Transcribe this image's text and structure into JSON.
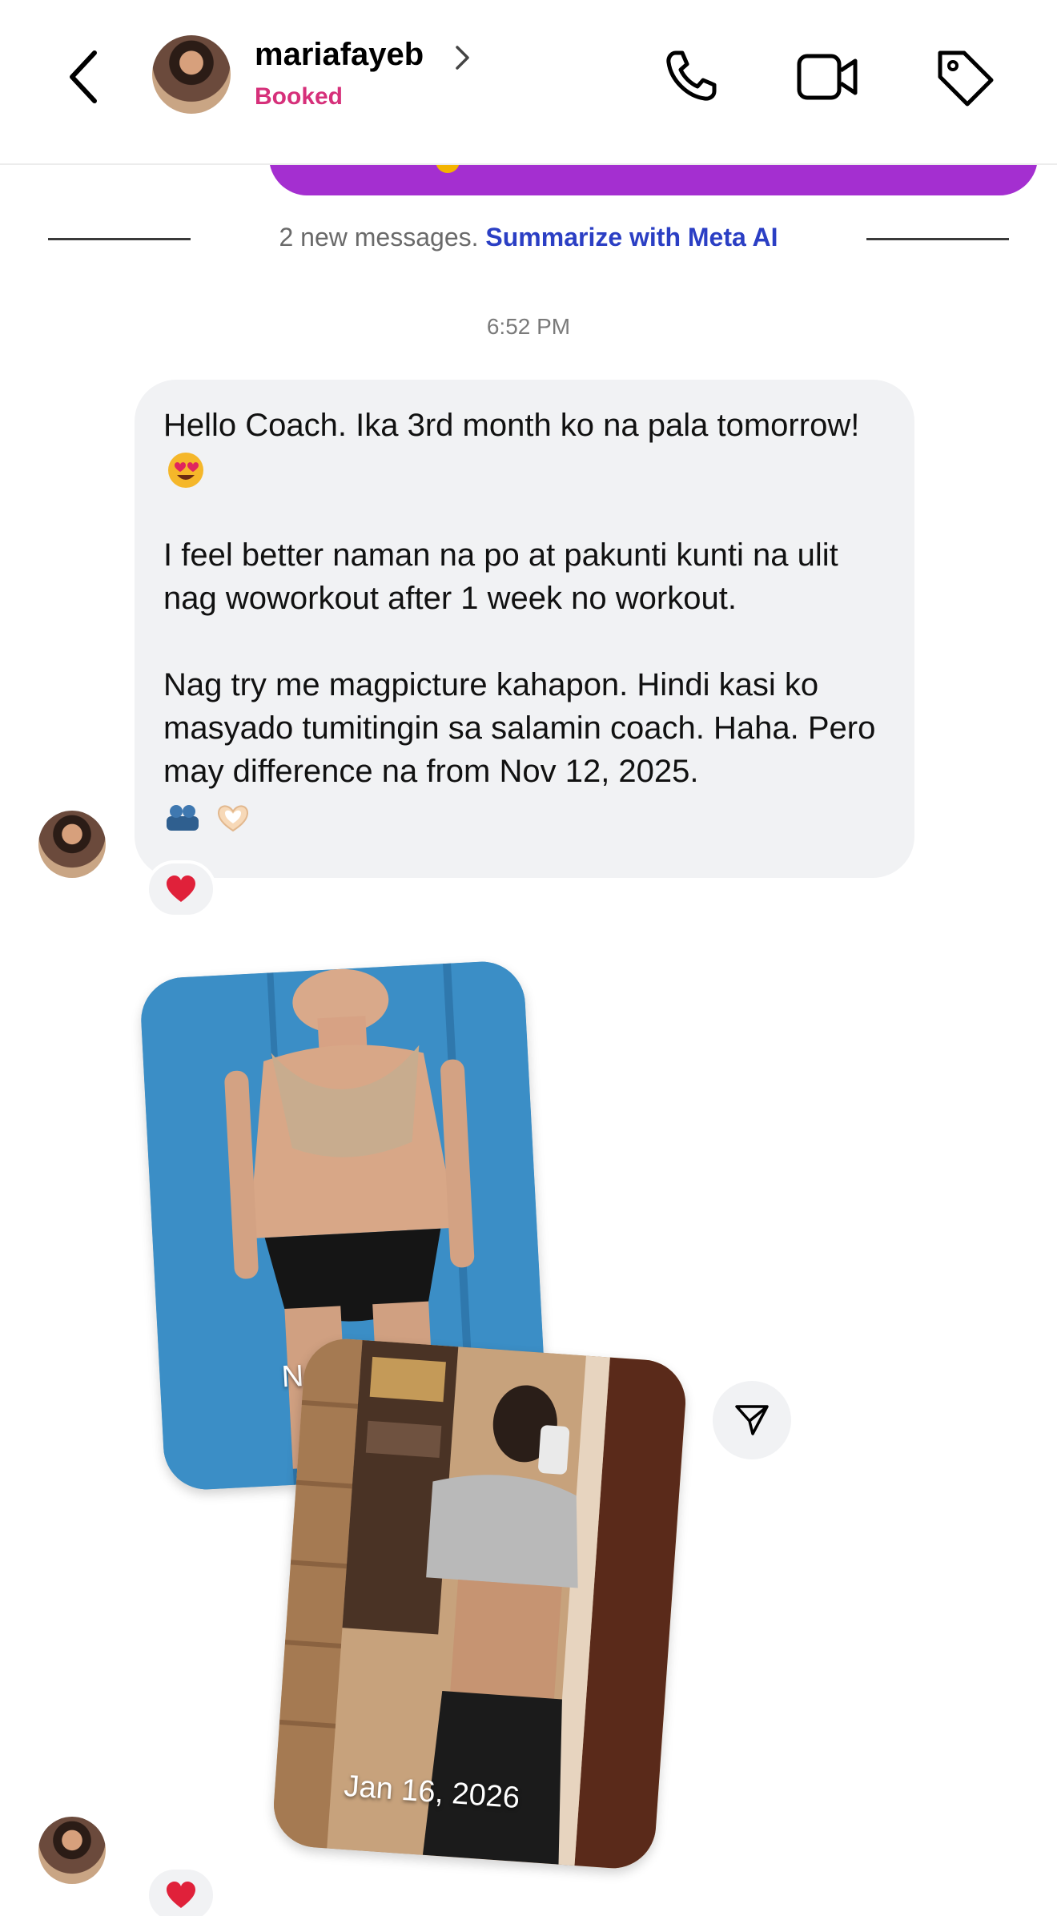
{
  "header": {
    "contact_name": "mariafayeb",
    "contact_status": "Booked",
    "icons": {
      "back": "chevron-left-icon",
      "profile": "chevron-right-icon",
      "call": "phone-icon",
      "video": "video-camera-icon",
      "label": "tag-icon"
    }
  },
  "divider": {
    "text": "2 new messages.",
    "link": "Summarize with Meta AI"
  },
  "timestamp": "6:52 PM",
  "message": {
    "paragraphs": [
      "Hello Coach. Ika 3rd month ko na pala tomorrow!",
      "I feel better naman na po at pakunti kunti na ulit nag woworkout after 1 week no workout.",
      "Nag try me magpicture kahapon. Hindi kasi ko masyado tumitingin sa salamin coach. Haha. Pero may difference na from Nov 12, 2025."
    ],
    "emojis": [
      "heart-eyes-emoji",
      "dumbbell-emoji",
      "heart-hands-emoji"
    ],
    "reaction": "heart-emoji"
  },
  "photos": [
    {
      "caption": "No"
    },
    {
      "caption": "Jan 16, 2026"
    }
  ],
  "share_icon": "send-icon",
  "photo_reaction": "heart-emoji",
  "colors": {
    "accent_status": "#d6307a",
    "link": "#2b3fc4",
    "outgoing_bubble": "#a42fd0",
    "incoming_bubble": "#f1f2f4"
  }
}
